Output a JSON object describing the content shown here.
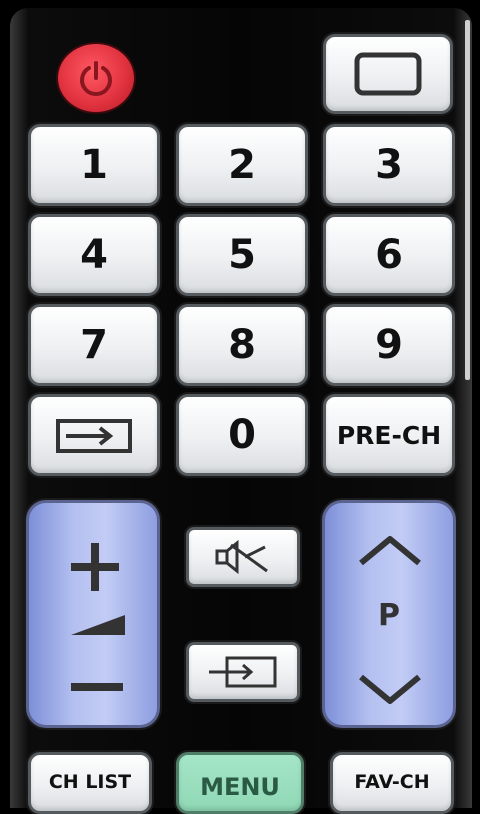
{
  "remote": {
    "power_icon": "power-icon",
    "source_icon": "screen-icon",
    "numbers": [
      "1",
      "2",
      "3",
      "4",
      "5",
      "6",
      "7",
      "8",
      "9",
      "0"
    ],
    "input_icon": "input-source-icon",
    "pre_ch_label": "PRE-CH",
    "volume": {
      "up_icon": "plus-icon",
      "level_icon": "volume-level-icon",
      "down_icon": "minus-icon"
    },
    "mute_icon": "mute-icon",
    "input2_icon": "input-arrow-icon",
    "channel": {
      "up_icon": "chevron-up-icon",
      "label": "P",
      "down_icon": "chevron-down-icon"
    },
    "bottom": {
      "ch_list_label": "CH LIST",
      "menu_label": "MENU",
      "fav_ch_label": "FAV-CH"
    },
    "colors": {
      "power": "#e23340",
      "rocker": "#b4c0f0",
      "menu": "#8fd8b5"
    }
  }
}
